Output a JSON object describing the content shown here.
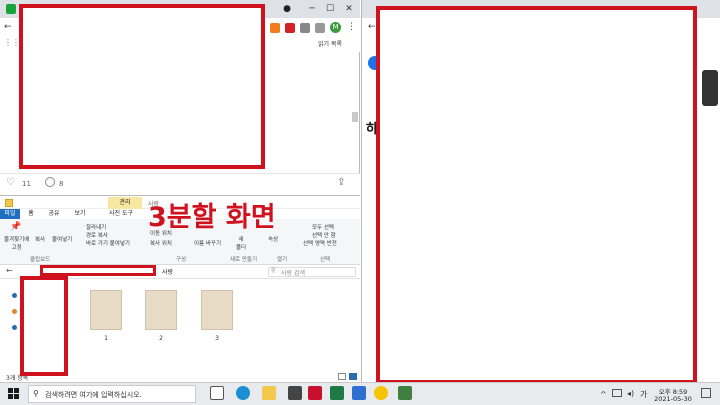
{
  "top_left_browser": {
    "bookmark_label": "읽기 목록",
    "profile_initial": "M",
    "likes": "11",
    "comments": "8"
  },
  "explorer": {
    "tab_manage": "관리",
    "window_title": "사랑",
    "ribbon_tabs": [
      "파일",
      "홈",
      "공유",
      "보기",
      "사진 도구"
    ],
    "ribbon_items": {
      "pin": "즐겨찾기에\n고정",
      "copy": "복사",
      "paste": "붙여넣기",
      "cut": "잘라내기",
      "copy_path": "경로 복사",
      "paste_shortcut": "바로 가기 붙여넣기",
      "move_to": "이동 위치",
      "copy_to": "복사 위치",
      "delete": "삭제",
      "rename": "이름 바꾸기",
      "new_folder": "새\n폴더",
      "properties": "속성",
      "select_all": "모두 선택",
      "select_none": "선택 안 함",
      "invert_selection": "선택 영역 반전"
    },
    "groups": [
      "클립보드",
      "구성",
      "새로 만들기",
      "열기",
      "선택"
    ],
    "address_folder": "사랑",
    "search_placeholder": "사랑 검색",
    "files": [
      "1",
      "2",
      "3"
    ],
    "status": "3개 항목"
  },
  "overlay": {
    "title": "3분할 화면",
    "accent_color": "#d0121f"
  },
  "taskbar": {
    "search_placeholder": "검색하려면 여기에 입력하십시오.",
    "time": "오후 8:59",
    "date": "2021-05-30",
    "ime": "가"
  },
  "top_right_browser": {
    "partial_text": "하"
  }
}
